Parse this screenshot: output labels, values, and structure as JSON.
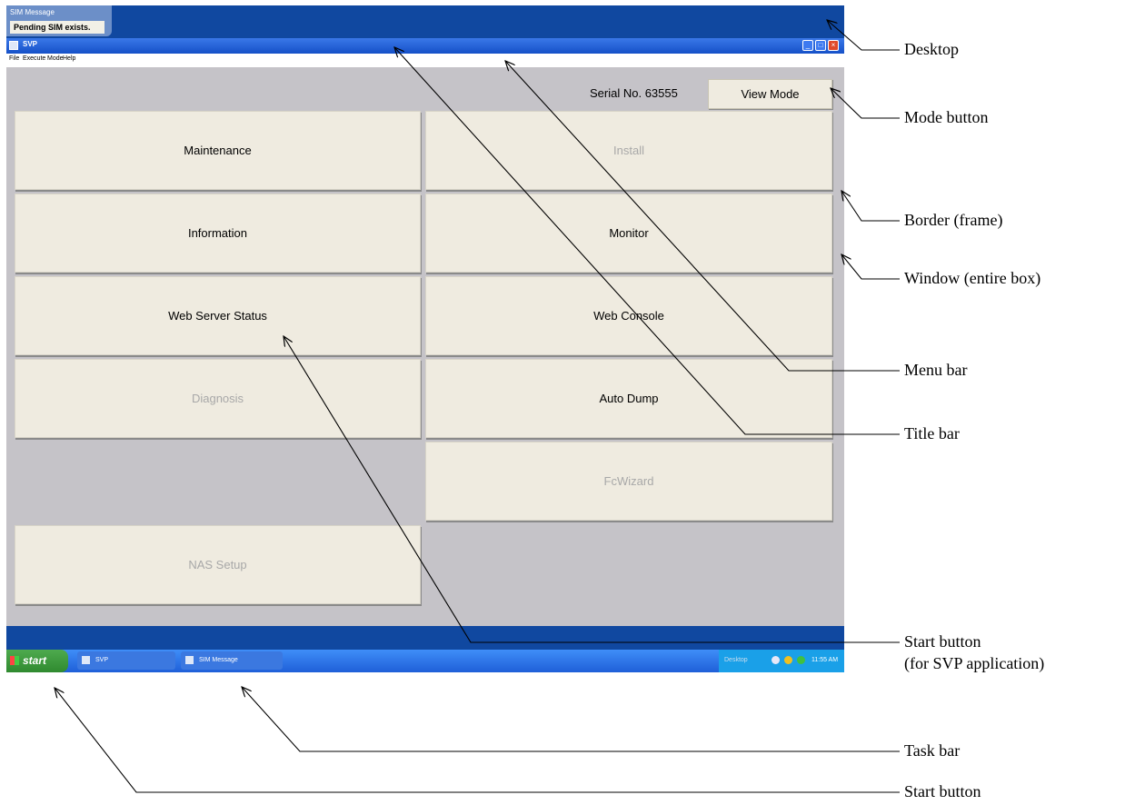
{
  "sim_popup": {
    "title": "SIM Message",
    "message": "Pending SIM exists."
  },
  "window": {
    "title": "SVP",
    "menu": [
      "File",
      "Execute",
      "Mode",
      "Help"
    ],
    "serial": "Serial No. 63555",
    "mode_button": "View Mode",
    "buttons": [
      {
        "label": "Maintenance",
        "enabled": true
      },
      {
        "label": "Install",
        "enabled": false
      },
      {
        "label": "Information",
        "enabled": true
      },
      {
        "label": "Monitor",
        "enabled": true
      },
      {
        "label": "Web Server Status",
        "enabled": true
      },
      {
        "label": "Web Console",
        "enabled": true
      },
      {
        "label": "Diagnosis",
        "enabled": false
      },
      {
        "label": "Auto Dump",
        "enabled": true
      },
      {
        "label": "FcWizard",
        "enabled": false
      },
      {
        "label": "NAS Setup",
        "enabled": false
      }
    ]
  },
  "taskbar": {
    "start_label": "start",
    "items": [
      "SVP",
      "SIM Message"
    ],
    "tray_desktop": "Desktop",
    "clock": "11:55 AM"
  },
  "annotations": {
    "desktop": "Desktop",
    "mode_button": "Mode button",
    "border": "Border (frame)",
    "window": "Window (entire box)",
    "menu_bar": "Menu bar",
    "title_bar": "Title bar",
    "start_button_svp_line1": "Start button",
    "start_button_svp_line2": "(for SVP application)",
    "task_bar": "Task bar",
    "start_button": "Start button"
  },
  "colors": {
    "desktop_blue": "#1048a0",
    "window_gray": "#c5c3c8",
    "button_face": "#efebe0",
    "taskbar_blue": "#2f6fe0",
    "start_green": "#3c9a3c"
  }
}
